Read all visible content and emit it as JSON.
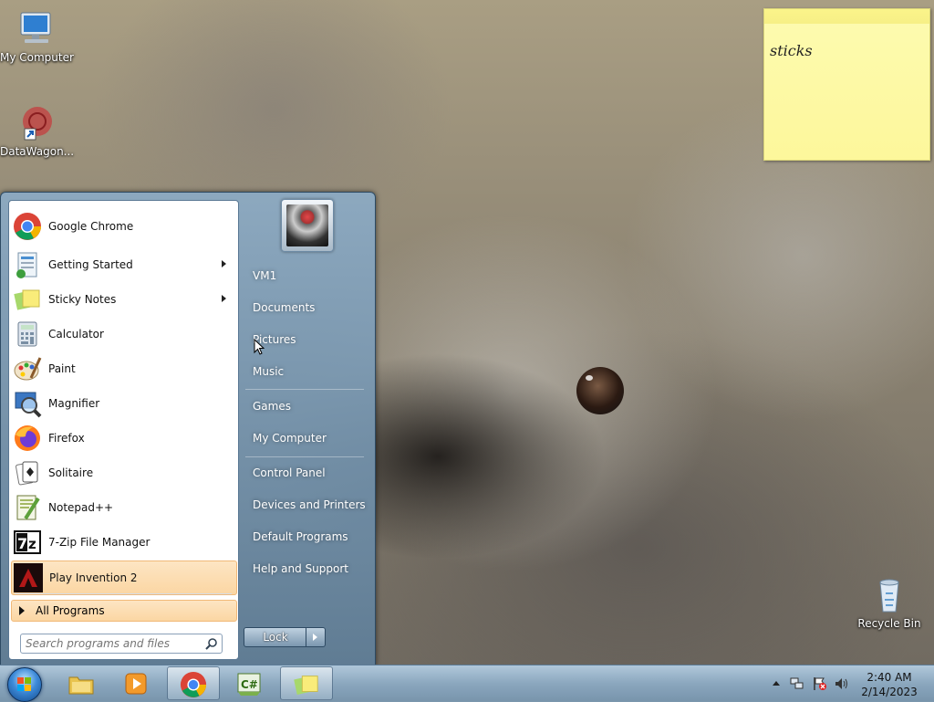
{
  "desktop": {
    "icons": [
      {
        "label": "My Computer",
        "icon": "computer-icon"
      },
      {
        "label": "DataWagon...",
        "icon": "datawagon-shortcut-icon"
      },
      {
        "label": "Recycle Bin",
        "icon": "recycle-bin-icon"
      }
    ]
  },
  "sticky_note": {
    "text": "sticks"
  },
  "start_menu": {
    "programs": [
      {
        "label": "Google Chrome",
        "icon": "chrome-icon"
      },
      {
        "label": "Getting Started",
        "icon": "getting-started-icon",
        "submenu": true
      },
      {
        "label": "Sticky Notes",
        "icon": "sticky-notes-icon",
        "submenu": true
      },
      {
        "label": "Calculator",
        "icon": "calculator-icon"
      },
      {
        "label": "Paint",
        "icon": "paint-icon"
      },
      {
        "label": "Magnifier",
        "icon": "magnifier-icon"
      },
      {
        "label": "Firefox",
        "icon": "firefox-icon"
      },
      {
        "label": "Solitaire",
        "icon": "solitaire-icon"
      },
      {
        "label": "Notepad++",
        "icon": "notepadpp-icon"
      },
      {
        "label": "7-Zip File Manager",
        "icon": "7zip-icon"
      },
      {
        "label": "Play Invention 2",
        "icon": "play-invention-icon",
        "highlighted": true
      }
    ],
    "all_programs": "All Programs",
    "search_placeholder": "Search programs and files",
    "right_items": [
      {
        "label": "VM1"
      },
      {
        "label": "Documents"
      },
      {
        "label": "Pictures"
      },
      {
        "label": "Music"
      },
      {
        "label": "Games"
      },
      {
        "label": "My Computer"
      },
      {
        "label": "Control Panel"
      },
      {
        "label": "Devices and Printers"
      },
      {
        "label": "Default Programs"
      },
      {
        "label": "Help and Support"
      }
    ],
    "lock_label": "Lock"
  },
  "taskbar": {
    "buttons": [
      {
        "name": "explorer",
        "icon": "folder-icon"
      },
      {
        "name": "media-player",
        "icon": "media-player-icon"
      },
      {
        "name": "chrome",
        "icon": "chrome-icon",
        "active": true
      },
      {
        "name": "csharp",
        "icon": "csharp-icon"
      },
      {
        "name": "sticky-notes",
        "icon": "sticky-notes-icon",
        "active": true
      }
    ],
    "clock": {
      "time": "2:40 AM",
      "date": "2/14/2023"
    }
  },
  "colors": {
    "start_menu_glass": "#7b9ab4",
    "highlight": "#fbd6a3",
    "sticky_note": "#fdf79b"
  }
}
